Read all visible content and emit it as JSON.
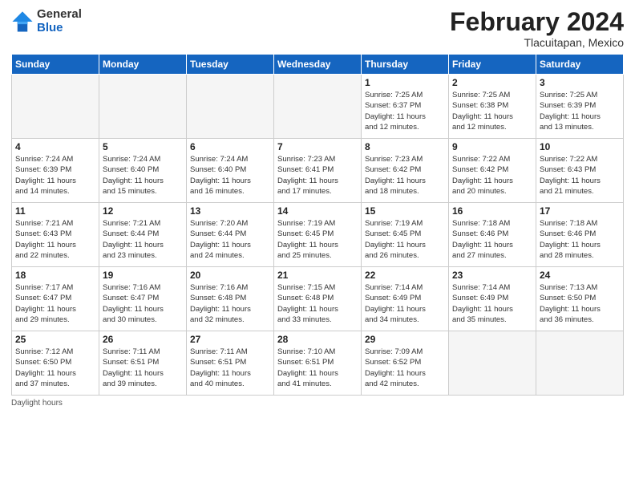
{
  "header": {
    "logo_general": "General",
    "logo_blue": "Blue",
    "month_title": "February 2024",
    "location": "Tlacuitapan, Mexico"
  },
  "days_of_week": [
    "Sunday",
    "Monday",
    "Tuesday",
    "Wednesday",
    "Thursday",
    "Friday",
    "Saturday"
  ],
  "weeks": [
    [
      {
        "day": "",
        "empty": true
      },
      {
        "day": "",
        "empty": true
      },
      {
        "day": "",
        "empty": true
      },
      {
        "day": "",
        "empty": true
      },
      {
        "day": "1",
        "sunrise": "7:25 AM",
        "sunset": "6:37 PM",
        "daylight": "11 hours and 12 minutes."
      },
      {
        "day": "2",
        "sunrise": "7:25 AM",
        "sunset": "6:38 PM",
        "daylight": "11 hours and 12 minutes."
      },
      {
        "day": "3",
        "sunrise": "7:25 AM",
        "sunset": "6:39 PM",
        "daylight": "11 hours and 13 minutes."
      }
    ],
    [
      {
        "day": "4",
        "sunrise": "7:24 AM",
        "sunset": "6:39 PM",
        "daylight": "11 hours and 14 minutes."
      },
      {
        "day": "5",
        "sunrise": "7:24 AM",
        "sunset": "6:40 PM",
        "daylight": "11 hours and 15 minutes."
      },
      {
        "day": "6",
        "sunrise": "7:24 AM",
        "sunset": "6:40 PM",
        "daylight": "11 hours and 16 minutes."
      },
      {
        "day": "7",
        "sunrise": "7:23 AM",
        "sunset": "6:41 PM",
        "daylight": "11 hours and 17 minutes."
      },
      {
        "day": "8",
        "sunrise": "7:23 AM",
        "sunset": "6:42 PM",
        "daylight": "11 hours and 18 minutes."
      },
      {
        "day": "9",
        "sunrise": "7:22 AM",
        "sunset": "6:42 PM",
        "daylight": "11 hours and 20 minutes."
      },
      {
        "day": "10",
        "sunrise": "7:22 AM",
        "sunset": "6:43 PM",
        "daylight": "11 hours and 21 minutes."
      }
    ],
    [
      {
        "day": "11",
        "sunrise": "7:21 AM",
        "sunset": "6:43 PM",
        "daylight": "11 hours and 22 minutes."
      },
      {
        "day": "12",
        "sunrise": "7:21 AM",
        "sunset": "6:44 PM",
        "daylight": "11 hours and 23 minutes."
      },
      {
        "day": "13",
        "sunrise": "7:20 AM",
        "sunset": "6:44 PM",
        "daylight": "11 hours and 24 minutes."
      },
      {
        "day": "14",
        "sunrise": "7:19 AM",
        "sunset": "6:45 PM",
        "daylight": "11 hours and 25 minutes."
      },
      {
        "day": "15",
        "sunrise": "7:19 AM",
        "sunset": "6:45 PM",
        "daylight": "11 hours and 26 minutes."
      },
      {
        "day": "16",
        "sunrise": "7:18 AM",
        "sunset": "6:46 PM",
        "daylight": "11 hours and 27 minutes."
      },
      {
        "day": "17",
        "sunrise": "7:18 AM",
        "sunset": "6:46 PM",
        "daylight": "11 hours and 28 minutes."
      }
    ],
    [
      {
        "day": "18",
        "sunrise": "7:17 AM",
        "sunset": "6:47 PM",
        "daylight": "11 hours and 29 minutes."
      },
      {
        "day": "19",
        "sunrise": "7:16 AM",
        "sunset": "6:47 PM",
        "daylight": "11 hours and 30 minutes."
      },
      {
        "day": "20",
        "sunrise": "7:16 AM",
        "sunset": "6:48 PM",
        "daylight": "11 hours and 32 minutes."
      },
      {
        "day": "21",
        "sunrise": "7:15 AM",
        "sunset": "6:48 PM",
        "daylight": "11 hours and 33 minutes."
      },
      {
        "day": "22",
        "sunrise": "7:14 AM",
        "sunset": "6:49 PM",
        "daylight": "11 hours and 34 minutes."
      },
      {
        "day": "23",
        "sunrise": "7:14 AM",
        "sunset": "6:49 PM",
        "daylight": "11 hours and 35 minutes."
      },
      {
        "day": "24",
        "sunrise": "7:13 AM",
        "sunset": "6:50 PM",
        "daylight": "11 hours and 36 minutes."
      }
    ],
    [
      {
        "day": "25",
        "sunrise": "7:12 AM",
        "sunset": "6:50 PM",
        "daylight": "11 hours and 37 minutes."
      },
      {
        "day": "26",
        "sunrise": "7:11 AM",
        "sunset": "6:51 PM",
        "daylight": "11 hours and 39 minutes."
      },
      {
        "day": "27",
        "sunrise": "7:11 AM",
        "sunset": "6:51 PM",
        "daylight": "11 hours and 40 minutes."
      },
      {
        "day": "28",
        "sunrise": "7:10 AM",
        "sunset": "6:51 PM",
        "daylight": "11 hours and 41 minutes."
      },
      {
        "day": "29",
        "sunrise": "7:09 AM",
        "sunset": "6:52 PM",
        "daylight": "11 hours and 42 minutes."
      },
      {
        "day": "",
        "empty": true
      },
      {
        "day": "",
        "empty": true
      }
    ]
  ],
  "footer": {
    "daylight_label": "Daylight hours"
  }
}
